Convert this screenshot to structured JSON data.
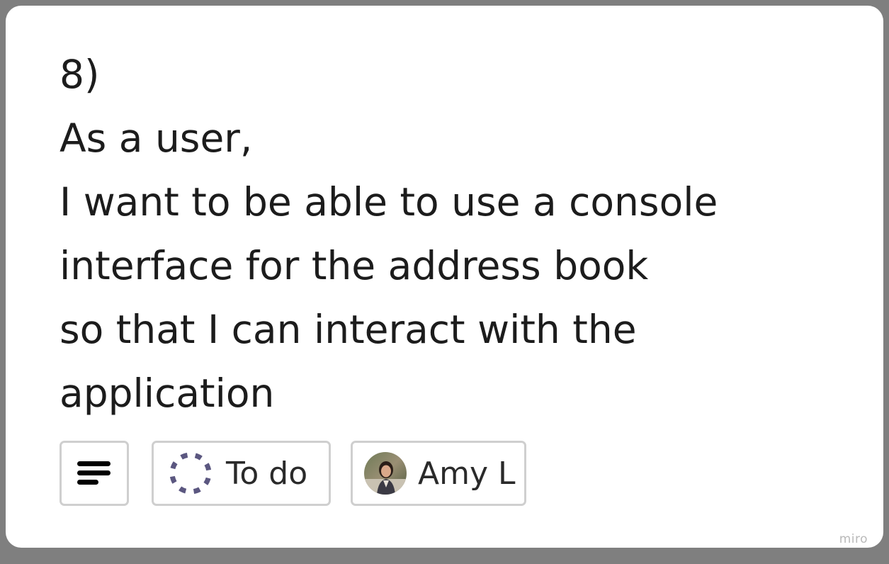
{
  "card": {
    "lines": [
      "8)",
      "As a user,",
      "I want to be able to use a console",
      "interface for the address book",
      "so that I can interact with the",
      "application"
    ]
  },
  "chips": {
    "description_icon": "description-lines-icon",
    "status": {
      "icon": "dashed-circle-status-icon",
      "label": "To do",
      "color": "#5b5780"
    },
    "assignee": {
      "name": "Amy L",
      "avatar": "user-avatar-photo"
    }
  },
  "watermark": "miro"
}
